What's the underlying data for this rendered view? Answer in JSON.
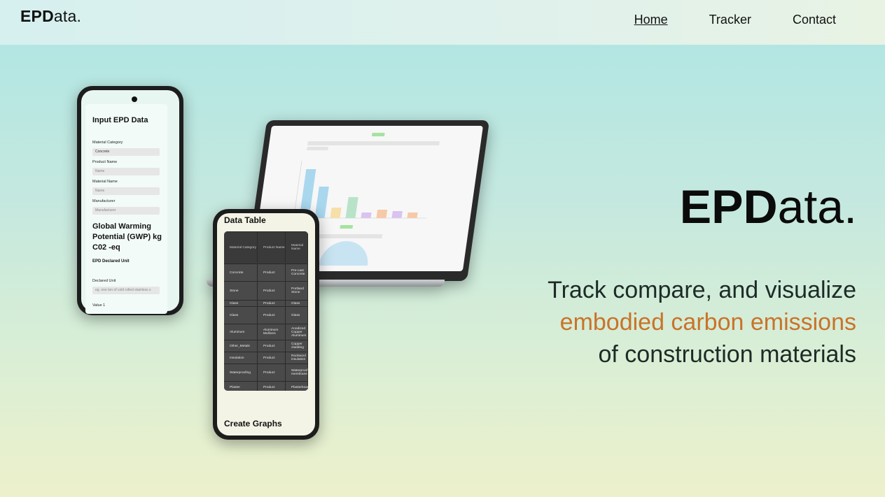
{
  "nav": {
    "logo_bold": "EPD",
    "logo_rest": "ata.",
    "links": [
      {
        "label": "Home",
        "active": true
      },
      {
        "label": "Tracker",
        "active": false
      },
      {
        "label": "Contact",
        "active": false
      }
    ]
  },
  "hero": {
    "title_bold": "EPD",
    "title_rest": "ata.",
    "tagline_line1": "Track compare, and visualize",
    "tagline_accent": "embodied carbon emissions",
    "tagline_line3": "of construction materials",
    "accent_color": "#c9732a"
  },
  "phone_input": {
    "title": "Input EPD Data",
    "material_category_label": "Material Category",
    "material_category_value": "Concrete",
    "product_name_label": "Product Name",
    "product_name_placeholder": "Name",
    "material_name_label": "Material Name",
    "material_name_placeholder": "Name",
    "manufacturer_label": "Manufacturer",
    "manufacturer_placeholder": "Manufacturer",
    "gwp_heading": "Global Warming Potential (GWP) kg C02 -eq",
    "declared_unit_heading": "EPD Declared Unit",
    "declared_unit_label": "Declared Unit",
    "declared_unit_placeholder": "eg. one ton of cold rolled stainless s",
    "value_label": "Value 1"
  },
  "phone_table": {
    "title": "Data Table",
    "headers": [
      "Material Category",
      "Product Name",
      "Material Name"
    ],
    "rows": [
      [
        "Concrete",
        "Product",
        "Pre-cast Concrete"
      ],
      [
        "Stone",
        "Product",
        "Portland Stone"
      ],
      [
        "Glass",
        "Product",
        "Glass"
      ],
      [
        "Glass",
        "Product",
        "Glass"
      ],
      [
        "Aluminum",
        "Aluminum Mullions",
        "Anodized Copper Aluminum"
      ],
      [
        "Other_Metals",
        "Product",
        "Copper cladding"
      ],
      [
        "Insulation",
        "Product",
        "Rockwool insulation"
      ],
      [
        "Waterproofing",
        "Product",
        "Waterproof membrane"
      ],
      [
        "Plaster",
        "Product",
        "Plasterboard"
      ]
    ],
    "graphs_label": "Create Graphs"
  },
  "laptop_chart": {
    "bar_colors": [
      "#a9d7ee",
      "#a9d7ee",
      "#f6e0a8",
      "#b8e3c9",
      "#d9c3ef",
      "#f6c9a8",
      "#d9c3ef",
      "#f6c9a8"
    ]
  }
}
